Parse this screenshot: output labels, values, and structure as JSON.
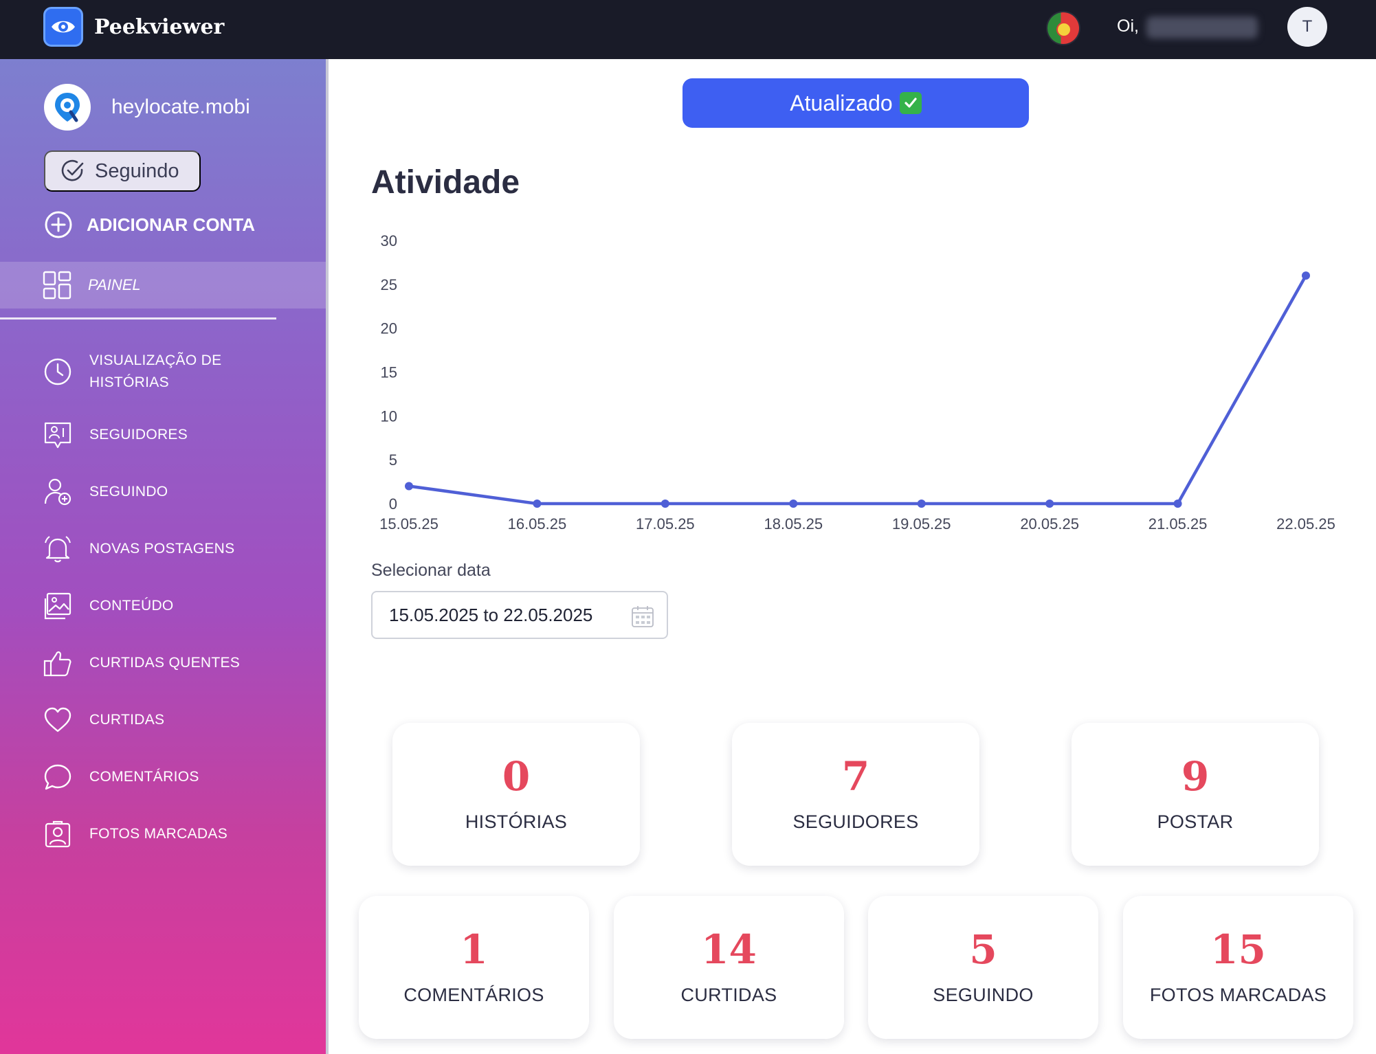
{
  "app": {
    "name": "Peekviewer"
  },
  "header": {
    "greeting": "Oi,",
    "user_name": "usuario",
    "avatar_initial": "T"
  },
  "sidebar": {
    "account_name": "heylocate.mobi",
    "following_button": "Seguindo",
    "add_account": "ADICIONAR CONTA",
    "active_item": "PAINEL",
    "items": [
      {
        "label": "VISUALIZAÇÃO DE\nHISTÓRIAS",
        "icon": "clock-icon"
      },
      {
        "label": "SEGUIDORES",
        "icon": "followers-icon"
      },
      {
        "label": "SEGUINDO",
        "icon": "add-user-icon"
      },
      {
        "label": "NOVAS POSTAGENS",
        "icon": "bell-icon"
      },
      {
        "label": "CONTEÚDO",
        "icon": "image-icon"
      },
      {
        "label": "CURTIDAS QUENTES",
        "icon": "thumbs-up-icon"
      },
      {
        "label": "CURTIDAS",
        "icon": "heart-icon"
      },
      {
        "label": "COMENTÁRIOS",
        "icon": "comment-icon"
      },
      {
        "label": "FOTOS MARCADAS",
        "icon": "tagged-photo-icon"
      }
    ]
  },
  "main": {
    "updated_button": "Atualizado",
    "activity_title": "Atividade",
    "date_label": "Selecionar data",
    "date_value": "15.05.2025 to 22.05.2025"
  },
  "chart_data": {
    "type": "line",
    "x": [
      "15.05.25",
      "16.05.25",
      "17.05.25",
      "18.05.25",
      "19.05.25",
      "20.05.25",
      "21.05.25",
      "22.05.25"
    ],
    "series": [
      {
        "values": [
          2,
          0,
          0,
          0,
          0,
          0,
          0,
          26
        ]
      }
    ],
    "y_ticks": [
      "0",
      "5",
      "10",
      "15",
      "20",
      "25",
      "30"
    ],
    "ylim": [
      0,
      30
    ],
    "grid": false,
    "color": "#4f5fd6"
  },
  "stats": {
    "historias": {
      "value": "0",
      "label": "HISTÓRIAS"
    },
    "seguidores": {
      "value": "7",
      "label": "SEGUIDORES"
    },
    "postar": {
      "value": "9",
      "label": "POSTAR"
    },
    "comentarios": {
      "value": "1",
      "label": "COMENTÁRIOS"
    },
    "curtidas": {
      "value": "14",
      "label": "CURTIDAS"
    },
    "seguindo": {
      "value": "5",
      "label": "SEGUINDO"
    },
    "fotos": {
      "value": "15",
      "label": "FOTOS MARCADAS"
    }
  }
}
